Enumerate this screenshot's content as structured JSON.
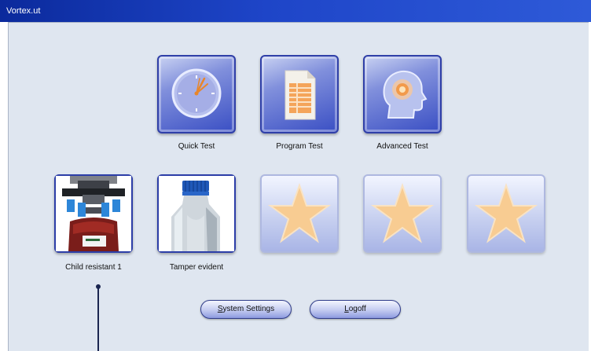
{
  "window": {
    "title": "Vortex.ut"
  },
  "top_tiles": [
    {
      "label": "Quick Test",
      "icon": "clock-icon"
    },
    {
      "label": "Program Test",
      "icon": "document-icon"
    },
    {
      "label": "Advanced Test",
      "icon": "head-icon"
    }
  ],
  "bottom_tiles": [
    {
      "label": "Child resistant 1",
      "icon": "child-resistant-cap-image"
    },
    {
      "label": "Tamper evident",
      "icon": "bottle-cap-image"
    },
    {
      "label": "",
      "icon": "star-icon"
    },
    {
      "label": "",
      "icon": "star-icon"
    },
    {
      "label": "",
      "icon": "star-icon"
    }
  ],
  "buttons": {
    "system_settings": {
      "accel": "S",
      "rest": "ystem Settings"
    },
    "logoff": {
      "accel": "L",
      "rest": "ogoff"
    }
  },
  "colors": {
    "title_bar": "#1e45c8",
    "client_bg": "#dfe6f0",
    "tile_border": "#2f3fa8",
    "star": "#f7c98e"
  }
}
